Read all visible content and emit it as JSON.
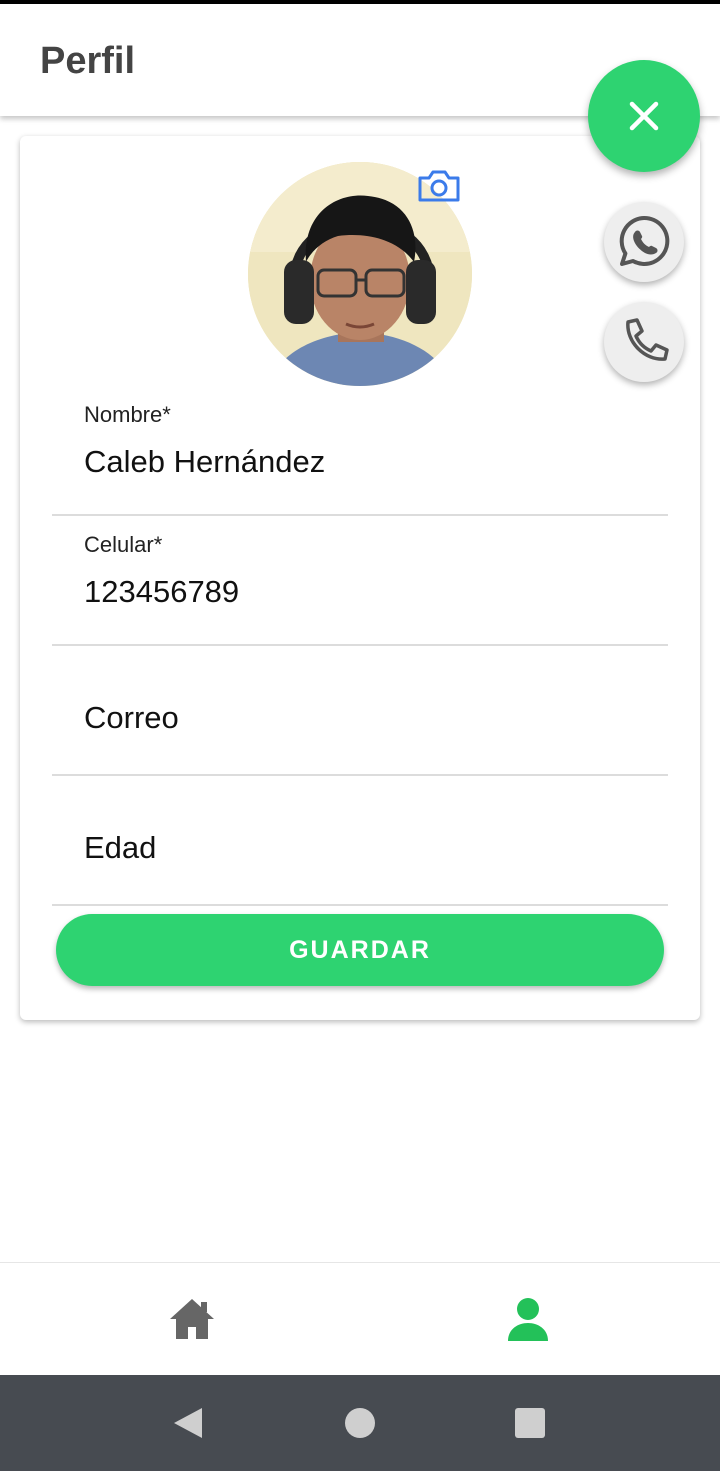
{
  "app_bar": {
    "title": "Perfil"
  },
  "profile": {
    "fields": [
      {
        "label": "Nombre*",
        "value": "Caleb Hernández"
      },
      {
        "label": "Celular*",
        "value": "123456789"
      },
      {
        "placeholder": "Correo"
      },
      {
        "placeholder": "Edad"
      }
    ],
    "save_label": "GUARDAR"
  },
  "fab": {
    "main_icon": "close-icon",
    "actions": [
      "whatsapp-icon",
      "phone-icon"
    ]
  },
  "bottom_nav": {
    "items": [
      {
        "icon": "home-icon",
        "active": false
      },
      {
        "icon": "person-icon",
        "active": true
      }
    ]
  },
  "colors": {
    "accent": "#2ED371",
    "camera_icon": "#3B7BEA",
    "nav_inactive": "#666666",
    "nav_active": "#23C159",
    "system_nav": "#474B51"
  }
}
